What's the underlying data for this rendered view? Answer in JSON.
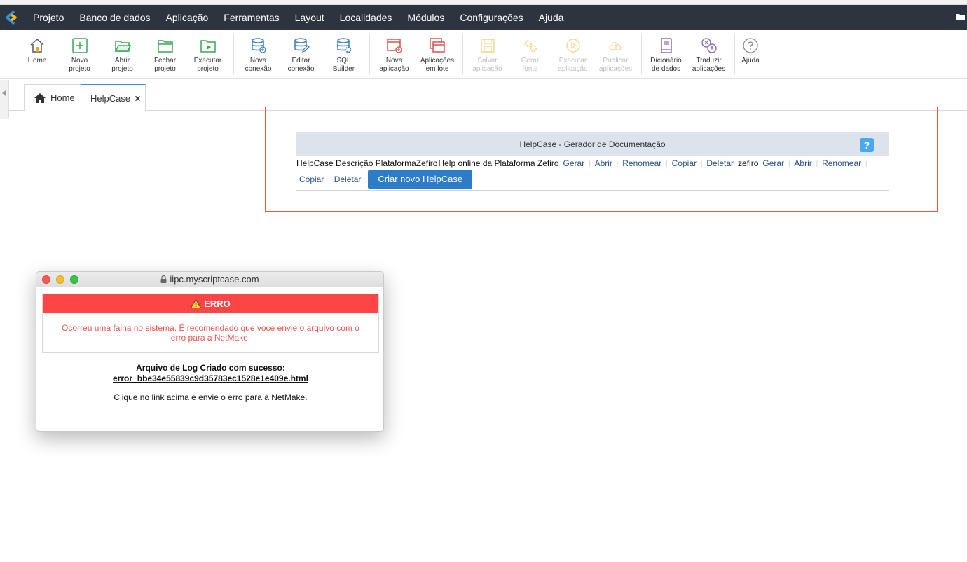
{
  "menu": {
    "items": [
      "Projeto",
      "Banco de dados",
      "Aplicação",
      "Ferramentas",
      "Layout",
      "Localidades",
      "Módulos",
      "Configurações",
      "Ajuda"
    ]
  },
  "toolbar": {
    "home": "Home",
    "new_project": "Novo\nprojeto",
    "open_project": "Abrir\nprojeto",
    "close_project": "Fechar\nprojeto",
    "run_project": "Executar\nprojeto",
    "new_connection": "Nova\nconexão",
    "edit_connection": "Editar\nconexão",
    "sql_builder": "SQL\nBuilder",
    "new_app": "Nova\naplicação",
    "batch_apps": "Aplicações\nem lote",
    "save_app": "Salvar\naplicação",
    "gen_source": "Gerar\nfonte",
    "run_app": "Executar\naplicação",
    "publish_apps": "Publicar\naplicações",
    "data_dictionary": "Dicionário\nde dados",
    "translate_apps": "Traduzir\naplicações",
    "help": "Ajuda"
  },
  "tabs": {
    "home": "Home",
    "active": "HelpCase"
  },
  "helpcase": {
    "header": "HelpCase - Gerador de Documentação",
    "help_icon": "?",
    "label_prefix": "HelpCase",
    "desc_label": "Descrição",
    "item1_name": "PlataformaZefiro",
    "item1_desc": "Help online da Plataforma Zefiro",
    "item2_name": "zefiro",
    "actions": {
      "gerar": "Gerar",
      "abrir": "Abrir",
      "renomear": "Renomear",
      "copiar": "Copiar",
      "deletar": "Deletar"
    },
    "pipe": "|",
    "new_button": "Criar novo HelpCase"
  },
  "popup": {
    "url": "iipc.myscriptcase.com",
    "error_title": "ERRO",
    "error_message": "Ocorreu uma falha no sistema. É recomendado que voce envie o arquivo com o erro para a NetMake.",
    "log_title": "Arquivo de Log Criado com sucesso:",
    "log_file": "error_bbe34e55839c9d35783ec1528e1e409e.html",
    "log_note": "Clique no link acima e envie o erro para à NetMake."
  },
  "colors": {
    "menubar": "#2c3440",
    "accent_blue": "#2d7cc7",
    "error_red": "#fc4544",
    "highlight_box": "#e8573f"
  }
}
